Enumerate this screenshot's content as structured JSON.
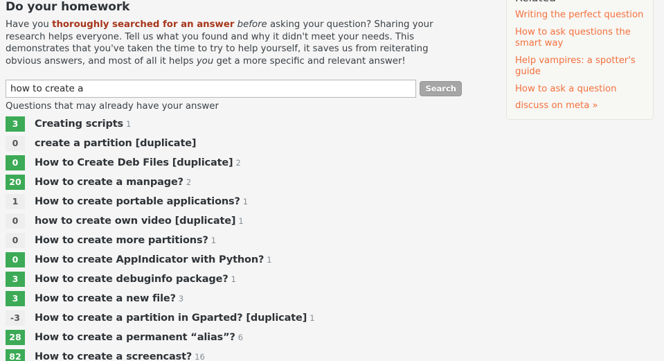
{
  "homework": {
    "heading": "Do your homework",
    "body_part1": "Have you ",
    "body_strong": "thoroughly searched for an answer",
    "body_part2": " ",
    "body_em1": "before",
    "body_part3": " asking your question? Sharing your research helps everyone. Tell us what you found and why it didn't meet your needs. This demonstrates that you've taken the time to try to help yourself, it saves us from reiterating obvious answers, and most of all it helps ",
    "body_em2": "you",
    "body_part4": " get a more specific and relevant answer!"
  },
  "search": {
    "value": "how to create a",
    "placeholder": "",
    "button_label": "Search"
  },
  "results": {
    "label": "Questions that may already have your answer",
    "questions": [
      {
        "score": "3",
        "answered": true,
        "title": "Creating scripts",
        "answers": "1"
      },
      {
        "score": "0",
        "answered": false,
        "title": "create a partition [duplicate]",
        "answers": ""
      },
      {
        "score": "0",
        "answered": true,
        "title": "How to Create Deb Files [duplicate]",
        "answers": "2"
      },
      {
        "score": "20",
        "answered": true,
        "title": "How to create a manpage?",
        "answers": "2"
      },
      {
        "score": "1",
        "answered": false,
        "title": "How to create portable applications?",
        "answers": "1"
      },
      {
        "score": "0",
        "answered": false,
        "title": "how to create own video [duplicate]",
        "answers": "1"
      },
      {
        "score": "0",
        "answered": false,
        "title": "How to create more partitions?",
        "answers": "1"
      },
      {
        "score": "0",
        "answered": true,
        "title": "How to create AppIndicator with Python?",
        "answers": "1"
      },
      {
        "score": "3",
        "answered": true,
        "title": "How to create debuginfo package?",
        "answers": "1"
      },
      {
        "score": "3",
        "answered": true,
        "title": "How to create a new file?",
        "answers": "3"
      },
      {
        "score": "-3",
        "answered": false,
        "title": "How to create a partition in Gparted? [duplicate]",
        "answers": "1"
      },
      {
        "score": "28",
        "answered": true,
        "title": "How to create a permanent “alias”?",
        "answers": "6"
      },
      {
        "score": "82",
        "answered": true,
        "title": "How to create a screencast?",
        "answers": "16"
      }
    ]
  },
  "sidebar": {
    "heading": "Related",
    "links": [
      {
        "label": "Writing the perfect question"
      },
      {
        "label": "How to ask questions the smart way"
      },
      {
        "label": "Help vampires: a spotter's guide"
      },
      {
        "label": "How to ask a question"
      },
      {
        "label": "discuss on meta »"
      }
    ]
  },
  "colors": {
    "accent_link": "#f4713d",
    "badge_answered": "#3caa56",
    "badge_unanswered": "#eeeeee",
    "strong_text": "#a6351a"
  }
}
